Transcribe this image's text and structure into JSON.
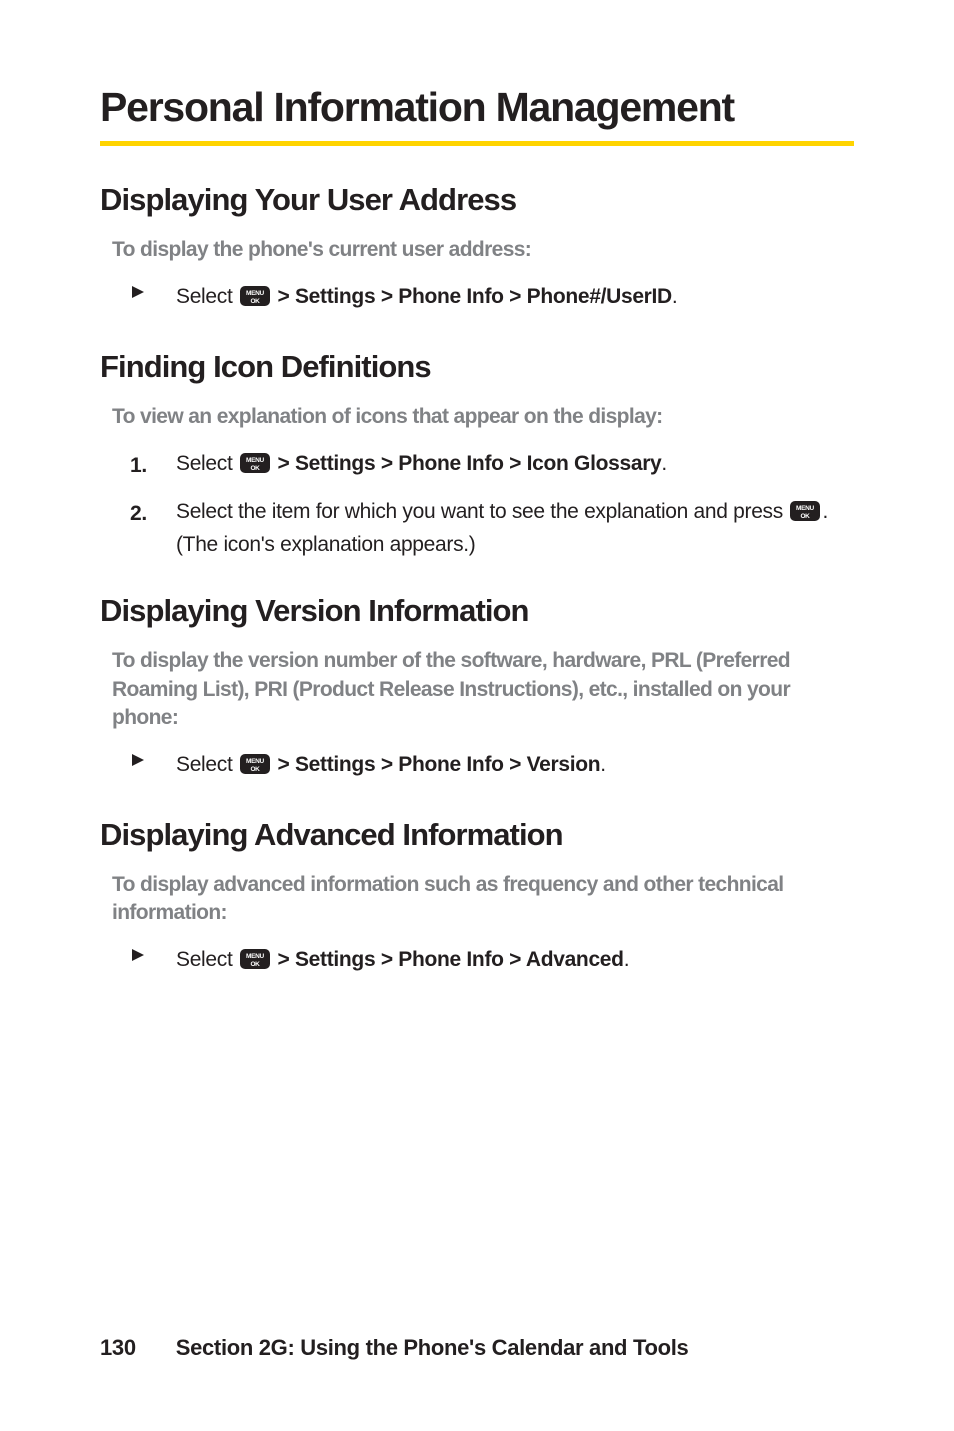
{
  "page_title": "Personal Information Management",
  "section1": {
    "heading": "Displaying Your User Address",
    "lead": "To display the phone's current user address:",
    "step_pre": "Select ",
    "step_bold": " > Settings > Phone Info > Phone#/UserID",
    "step_post": "."
  },
  "section2": {
    "heading": "Finding Icon Definitions",
    "lead": "To view an explanation of icons that appear on the display:",
    "step1_num": "1.",
    "step1_pre": "Select ",
    "step1_bold": " > Settings > Phone Info > Icon Glossary",
    "step1_post": ".",
    "step2_num": "2.",
    "step2_pre": "Select the item for which you want to see the explanation and press ",
    "step2_post": ". (The icon's explanation appears.)"
  },
  "section3": {
    "heading": "Displaying Version Information",
    "lead": "To display the version number of the software, hardware, PRL (Preferred Roaming List), PRI (Product Release Instructions), etc., installed on your phone:",
    "step_pre": "Select ",
    "step_bold": " > Settings > Phone Info > Version",
    "step_post": "."
  },
  "section4": {
    "heading": "Displaying Advanced Information",
    "lead": "To display advanced information such as frequency and other technical information:",
    "step_pre": "Select ",
    "step_bold": " > Settings > Phone Info > Advanced",
    "step_post": "."
  },
  "footer": {
    "page_number": "130",
    "section_label": "Section 2G: Using the Phone's Calendar and Tools"
  }
}
